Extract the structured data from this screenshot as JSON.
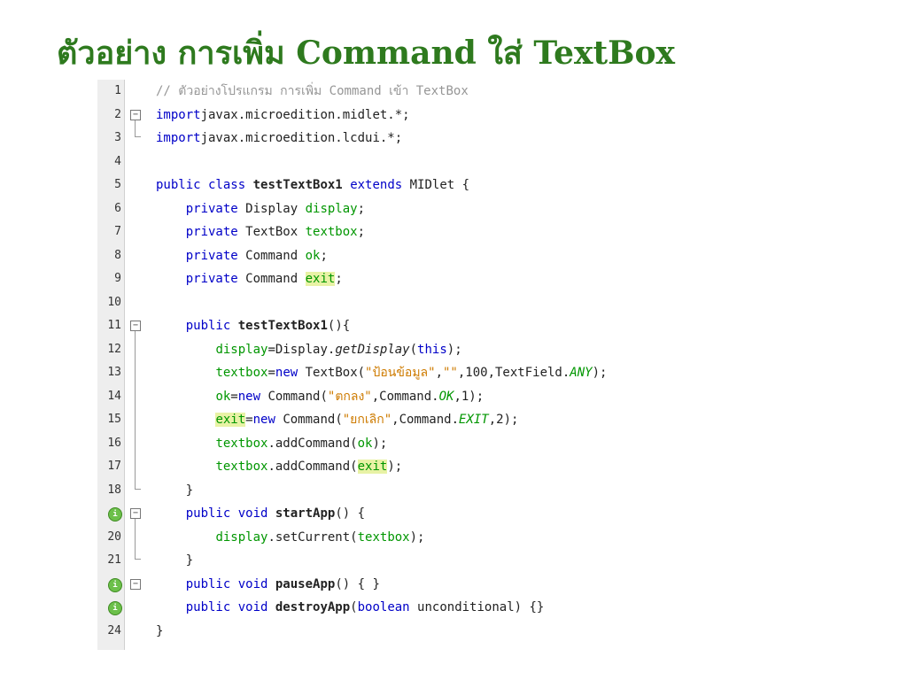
{
  "title": "ตัวอย่าง การเพิ่ม Command ใส่ TextBox",
  "colors": {
    "title": "#2e7a1e",
    "keyword": "#0000c8",
    "string": "#ce7b00",
    "field": "#009600",
    "comment": "#969696",
    "highlight": "#e8f2a5"
  },
  "badge_icon": "override-method-icon",
  "lines": [
    {
      "n": "1",
      "tokens": [
        [
          "cm",
          "// ตัวอย่างโปรแกรม การเพิ่ม Command เข้า TextBox"
        ]
      ]
    },
    {
      "n": "2",
      "tokens": [
        [
          "kw",
          "import"
        ],
        [
          "",
          "javax.microedition.midlet.*;"
        ]
      ]
    },
    {
      "n": "3",
      "tokens": [
        [
          "kw",
          "import"
        ],
        [
          "",
          "javax.microedition.lcdui.*;"
        ]
      ]
    },
    {
      "n": "4",
      "tokens": []
    },
    {
      "n": "5",
      "tokens": [
        [
          "kw",
          "public class"
        ],
        [
          "",
          " "
        ],
        [
          "b",
          "testTextBox1"
        ],
        [
          "",
          " "
        ],
        [
          "kw",
          "extends"
        ],
        [
          "",
          " MIDlet {"
        ]
      ]
    },
    {
      "n": "6",
      "tokens": [
        [
          "",
          "    "
        ],
        [
          "kw",
          "private"
        ],
        [
          "",
          " Display "
        ],
        [
          "fld",
          "display"
        ],
        [
          "",
          ";"
        ]
      ]
    },
    {
      "n": "7",
      "tokens": [
        [
          "",
          "    "
        ],
        [
          "kw",
          "private"
        ],
        [
          "",
          " TextBox "
        ],
        [
          "fld",
          "textbox"
        ],
        [
          "",
          ";"
        ]
      ]
    },
    {
      "n": "8",
      "tokens": [
        [
          "",
          "    "
        ],
        [
          "kw",
          "private"
        ],
        [
          "",
          " Command "
        ],
        [
          "fld",
          "ok"
        ],
        [
          "",
          ";"
        ]
      ]
    },
    {
      "n": "9",
      "tokens": [
        [
          "",
          "    "
        ],
        [
          "kw",
          "private"
        ],
        [
          "",
          " Command "
        ],
        [
          "fld hl",
          "exit"
        ],
        [
          "",
          ";"
        ]
      ]
    },
    {
      "n": "10",
      "tokens": []
    },
    {
      "n": "11",
      "tokens": [
        [
          "",
          "    "
        ],
        [
          "kw",
          "public"
        ],
        [
          "",
          " "
        ],
        [
          "b",
          "testTextBox1"
        ],
        [
          "",
          "(){"
        ]
      ]
    },
    {
      "n": "12",
      "tokens": [
        [
          "",
          "        "
        ],
        [
          "fld",
          "display"
        ],
        [
          "",
          "=Display."
        ],
        [
          "it",
          "getDisplay"
        ],
        [
          "",
          "("
        ],
        [
          "kw",
          "this"
        ],
        [
          "",
          ");"
        ]
      ]
    },
    {
      "n": "13",
      "tokens": [
        [
          "",
          "        "
        ],
        [
          "fld",
          "textbox"
        ],
        [
          "",
          "="
        ],
        [
          "kw",
          "new"
        ],
        [
          "",
          " TextBox("
        ],
        [
          "str",
          "\"ป้อนข้อมูล\""
        ],
        [
          "",
          ","
        ],
        [
          "str",
          "\"\""
        ],
        [
          "",
          ",100,TextField."
        ],
        [
          "sfld",
          "ANY"
        ],
        [
          "",
          ");"
        ]
      ]
    },
    {
      "n": "14",
      "tokens": [
        [
          "",
          "        "
        ],
        [
          "fld",
          "ok"
        ],
        [
          "",
          "="
        ],
        [
          "kw",
          "new"
        ],
        [
          "",
          " Command("
        ],
        [
          "str",
          "\"ตกลง\""
        ],
        [
          "",
          ",Command."
        ],
        [
          "sfld",
          "OK"
        ],
        [
          "",
          ",1);"
        ]
      ]
    },
    {
      "n": "15",
      "tokens": [
        [
          "",
          "        "
        ],
        [
          "fld hl",
          "exit"
        ],
        [
          "",
          "="
        ],
        [
          "kw",
          "new"
        ],
        [
          "",
          " Command("
        ],
        [
          "str",
          "\"ยกเลิก\""
        ],
        [
          "",
          ",Command."
        ],
        [
          "sfld",
          "EXIT"
        ],
        [
          "",
          ",2);"
        ]
      ]
    },
    {
      "n": "16",
      "tokens": [
        [
          "",
          "        "
        ],
        [
          "fld",
          "textbox"
        ],
        [
          "",
          ".addCommand("
        ],
        [
          "fld",
          "ok"
        ],
        [
          "",
          ");"
        ]
      ]
    },
    {
      "n": "17",
      "tokens": [
        [
          "",
          "        "
        ],
        [
          "fld",
          "textbox"
        ],
        [
          "",
          ".addCommand("
        ],
        [
          "fld hl",
          "exit"
        ],
        [
          "",
          ");"
        ]
      ]
    },
    {
      "n": "18",
      "tokens": [
        [
          "",
          "    }"
        ]
      ]
    },
    {
      "n": "",
      "badge": true,
      "tokens": [
        [
          "",
          "    "
        ],
        [
          "kw",
          "public void"
        ],
        [
          "",
          " "
        ],
        [
          "b",
          "startApp"
        ],
        [
          "",
          "() {"
        ]
      ]
    },
    {
      "n": "20",
      "tokens": [
        [
          "",
          "        "
        ],
        [
          "fld",
          "display"
        ],
        [
          "",
          ".setCurrent("
        ],
        [
          "fld",
          "textbox"
        ],
        [
          "",
          ");"
        ]
      ]
    },
    {
      "n": "21",
      "tokens": [
        [
          "",
          "    }"
        ]
      ]
    },
    {
      "n": "",
      "badge": true,
      "tokens": [
        [
          "",
          "    "
        ],
        [
          "kw",
          "public void"
        ],
        [
          "",
          " "
        ],
        [
          "b",
          "pauseApp"
        ],
        [
          "",
          "() { }"
        ]
      ]
    },
    {
      "n": "",
      "badge": true,
      "tokens": [
        [
          "",
          "    "
        ],
        [
          "kw",
          "public void"
        ],
        [
          "",
          " "
        ],
        [
          "b",
          "destroyApp"
        ],
        [
          "",
          "("
        ],
        [
          "kw",
          "boolean"
        ],
        [
          "",
          " unconditional) {}"
        ]
      ]
    },
    {
      "n": "24",
      "tokens": [
        [
          "",
          "}"
        ]
      ]
    }
  ]
}
